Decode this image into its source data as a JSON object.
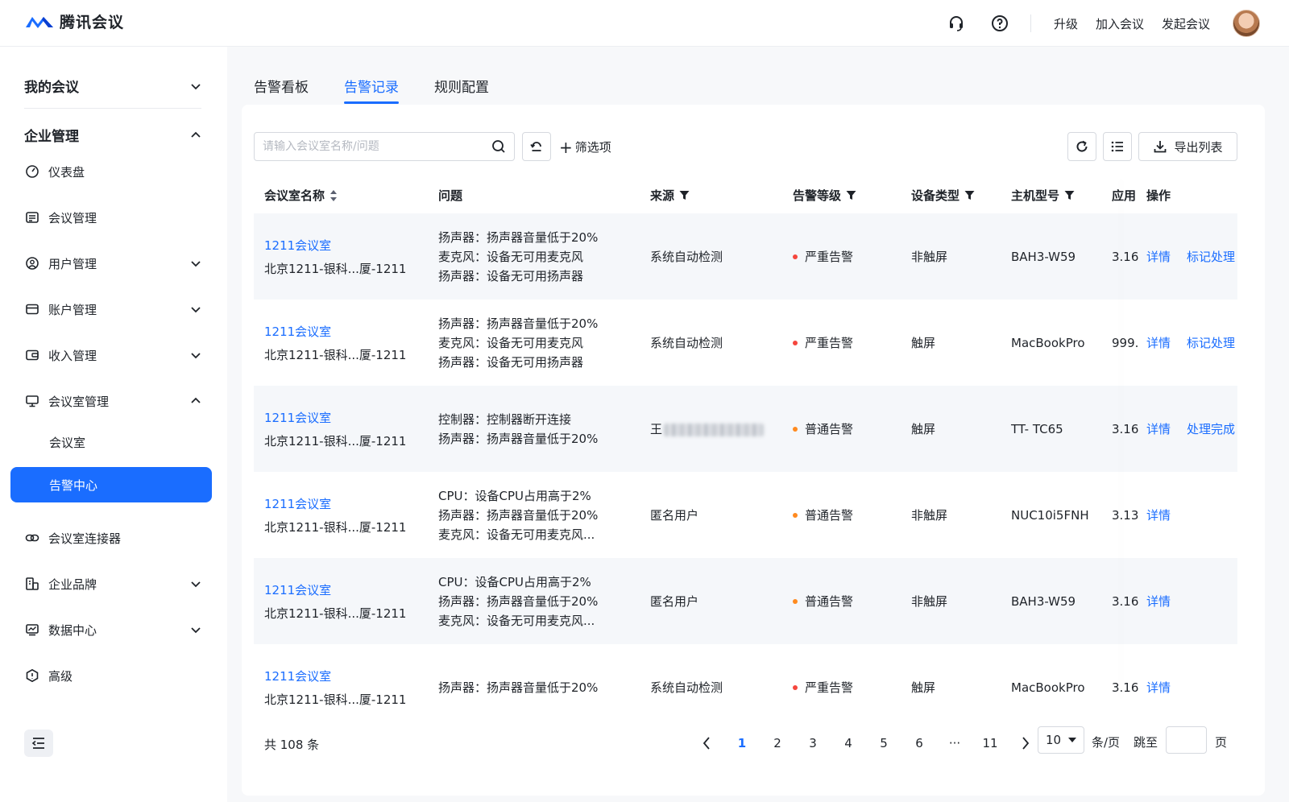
{
  "app": {
    "logo_text": "腾讯会议",
    "header_links": [
      "升级",
      "加入会议",
      "发起会议"
    ],
    "icons": [
      "headset-icon",
      "help-icon"
    ],
    "accent_color": "#1a6dff"
  },
  "sidebar": {
    "group_my_meetings": "我的会议",
    "group_enterprise": "企业管理",
    "items": [
      {
        "label": "仪表盘",
        "icon": "dashboard-icon"
      },
      {
        "label": "会议管理",
        "icon": "list-icon"
      },
      {
        "label": "用户管理",
        "icon": "user-icon"
      },
      {
        "label": "账户管理",
        "icon": "card-icon"
      },
      {
        "label": "收入管理",
        "icon": "wallet-icon"
      },
      {
        "label": "会议室管理",
        "icon": "monitor-icon"
      },
      {
        "label": "会议室连接器",
        "icon": "link-icon"
      },
      {
        "label": "企业品牌",
        "icon": "brand-icon"
      },
      {
        "label": "数据中心",
        "icon": "chart-icon"
      },
      {
        "label": "高级",
        "icon": "shield-icon"
      }
    ],
    "sub_items": [
      "会议室",
      "告警中心"
    ],
    "active": "告警中心"
  },
  "tabs": [
    "告警看板",
    "告警记录",
    "规则配置"
  ],
  "active_tab": "告警记录",
  "toolbar": {
    "search_placeholder": "请输入会议室名称/问题",
    "filter_add": "筛选项",
    "export": "导出列表"
  },
  "table": {
    "columns": [
      "会议室名称",
      "问题",
      "来源",
      "告警等级",
      "设备类型",
      "主机型号",
      "应用",
      "操作"
    ],
    "rows": [
      {
        "room": "1211会议室",
        "location": "北京1211-银科...厦-1211",
        "issues": [
          "扬声器：扬声器音量低于20%",
          "麦克风：设备无可用麦克风",
          "扬声器：设备无可用扬声器"
        ],
        "source": "系统自动检测",
        "source_blurred": false,
        "level": "严重告警",
        "level_color": "#f5463d",
        "device": "非触屏",
        "model": "BAH3-W59",
        "app": "3.16",
        "actions": [
          "详情",
          "标记处理"
        ]
      },
      {
        "room": "1211会议室",
        "location": "北京1211-银科...厦-1211",
        "issues": [
          "扬声器：扬声器音量低于20%",
          "麦克风：设备无可用麦克风",
          "扬声器：设备无可用扬声器"
        ],
        "source": "系统自动检测",
        "source_blurred": false,
        "level": "严重告警",
        "level_color": "#f5463d",
        "device": "触屏",
        "model": "MacBookPro",
        "app": "999.",
        "actions": [
          "详情",
          "标记处理"
        ]
      },
      {
        "room": "1211会议室",
        "location": "北京1211-银科...厦-1211",
        "issues": [
          "控制器：控制器断开连接",
          "扬声器：扬声器音量低于20%"
        ],
        "source": "王",
        "source_blurred": true,
        "level": "普通告警",
        "level_color": "#ff8a1f",
        "device": "触屏",
        "model": "TT- TC65",
        "app": "3.16",
        "actions": [
          "详情",
          "处理完成"
        ]
      },
      {
        "room": "1211会议室",
        "location": "北京1211-银科...厦-1211",
        "issues": [
          "CPU：设备CPU占用高于2%",
          "扬声器：扬声器音量低于20%",
          "麦克风：设备无可用麦克风..."
        ],
        "source": "匿名用户",
        "source_blurred": false,
        "level": "普通告警",
        "level_color": "#ff8a1f",
        "device": "非触屏",
        "model": "NUC10i5FNH",
        "app": "3.13",
        "actions": [
          "详情"
        ]
      },
      {
        "room": "1211会议室",
        "location": "北京1211-银科...厦-1211",
        "issues": [
          "CPU：设备CPU占用高于2%",
          "扬声器：扬声器音量低于20%",
          "麦克风：设备无可用麦克风..."
        ],
        "source": "匿名用户",
        "source_blurred": false,
        "level": "普通告警",
        "level_color": "#ff8a1f",
        "device": "非触屏",
        "model": "BAH3-W59",
        "app": "3.16",
        "actions": [
          "详情"
        ]
      },
      {
        "room": "1211会议室",
        "location": "北京1211-银科...厦-1211",
        "issues": [
          "扬声器：扬声器音量低于20%"
        ],
        "source": "系统自动检测",
        "source_blurred": false,
        "level": "严重告警",
        "level_color": "#f5463d",
        "device": "触屏",
        "model": "MacBookPro",
        "app": "3.16",
        "actions": [
          "详情"
        ]
      }
    ]
  },
  "pagination": {
    "total": "共 108 条",
    "pages": [
      "1",
      "2",
      "3",
      "4",
      "5",
      "6",
      "···",
      "11"
    ],
    "current": "1",
    "page_size": "10",
    "per_page_label": "条/页",
    "jump_label": "跳至",
    "page_suffix": "页"
  }
}
